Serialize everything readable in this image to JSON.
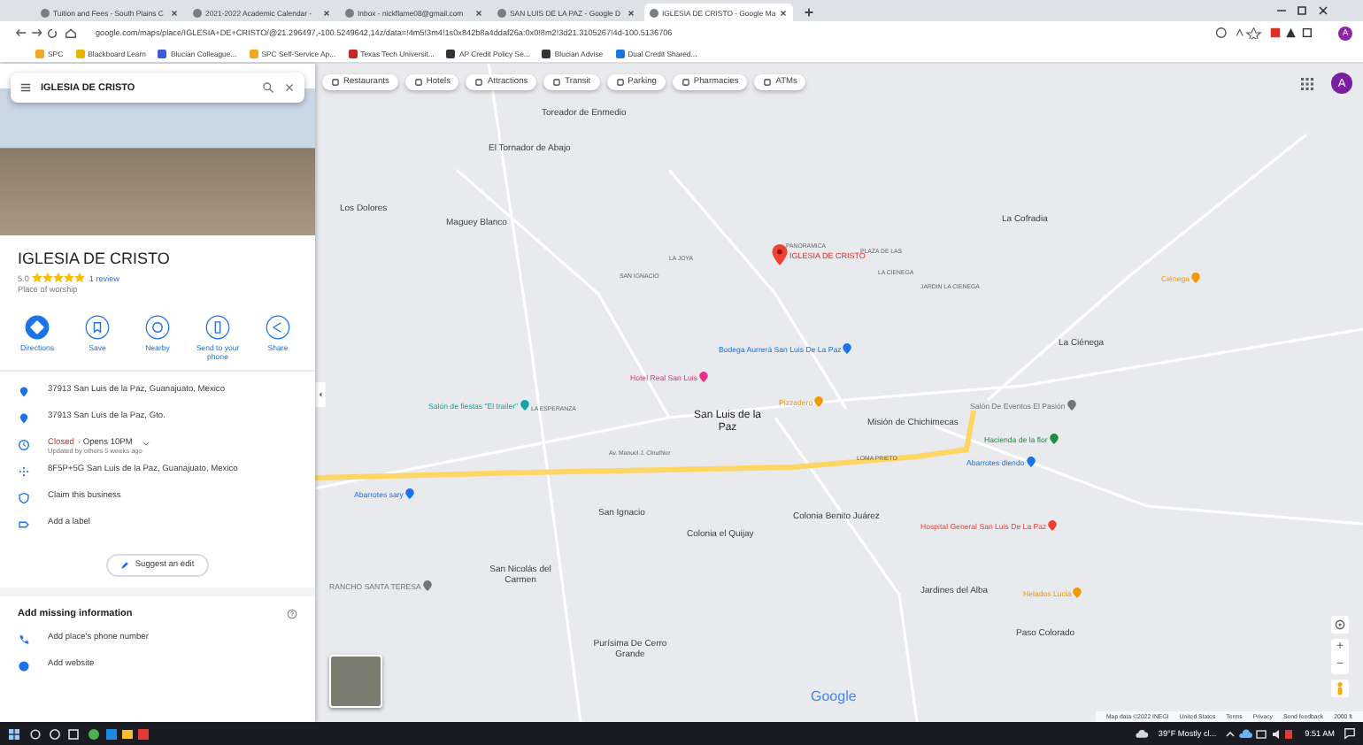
{
  "browser": {
    "tabs": [
      {
        "title": "Tuition and Fees - South Plains C",
        "selected": false
      },
      {
        "title": "2021-2022 Academic Calendar -",
        "selected": false
      },
      {
        "title": "Inbox - nickflame08@gmail.com",
        "selected": false
      },
      {
        "title": "SAN LUIS DE LA PAZ - Google D",
        "selected": false
      },
      {
        "title": "IGLESIA DE CRISTO - Google Ma",
        "selected": true
      }
    ],
    "url": "google.com/maps/place/IGLESIA+DE+CRISTO/@21.296497,-100.5249642,14z/data=!4m5!3m4!1s0x842b8a4ddaf26a:0x0!8m2!3d21.3105267!4d-100.5136706",
    "bookmarks": [
      {
        "label": "SPC",
        "color": "#f5a623"
      },
      {
        "label": "Blackboard Learn",
        "color": "#e8b400"
      },
      {
        "label": "Blucian Colleague...",
        "color": "#3b5bdb"
      },
      {
        "label": "SPC Self-Service Ap...",
        "color": "#f5a623"
      },
      {
        "label": "Texas Tech Universit...",
        "color": "#c62828"
      },
      {
        "label": "AP Credit Policy Se...",
        "color": "#333333"
      },
      {
        "label": "Blucian Advise",
        "color": "#333333"
      },
      {
        "label": "Dual Credit Shared...",
        "color": "#1a73e8"
      }
    ],
    "profile_initial": "A"
  },
  "panel": {
    "search": {
      "value": "IGLESIA DE CRISTO"
    },
    "title": "IGLESIA DE CRISTO",
    "rating": "5.0",
    "stars": 5,
    "reviews": "1 review",
    "category": "Place of worship",
    "actions": [
      {
        "label": "Directions",
        "selected": true
      },
      {
        "label": "Save",
        "selected": false
      },
      {
        "label": "Nearby",
        "selected": false
      },
      {
        "label": "Send to your phone",
        "selected": false
      },
      {
        "label": "Share",
        "selected": false
      }
    ],
    "info": [
      {
        "kind": "address",
        "text": "37913 San Luis de la Paz, Guanajuato, Mexico"
      },
      {
        "kind": "address",
        "text": "37913 San Luis de la Paz, Gto."
      },
      {
        "kind": "hours",
        "status": "Closed",
        "text": "· Opens 10PM",
        "note": "Updated by others 5 weeks ago"
      },
      {
        "kind": "pluscode",
        "text": "8F5P+5G San Luis de la Paz, Guanajuato, Mexico"
      },
      {
        "kind": "claim",
        "text": "Claim this business"
      },
      {
        "kind": "label",
        "text": "Add a label"
      }
    ],
    "suggest": "Suggest an edit",
    "missing_title": "Add missing information",
    "missing": [
      {
        "kind": "phone",
        "text": "Add place's phone number"
      },
      {
        "kind": "website",
        "text": "Add website"
      }
    ]
  },
  "map": {
    "chips": [
      "Restaurants",
      "Hotels",
      "Attractions",
      "Transit",
      "Parking",
      "Pharmacies",
      "ATMs"
    ],
    "avatar": "A",
    "place": {
      "label": "IGLESIA DE CRISTO"
    },
    "labels": [
      {
        "kind": "town",
        "text": "Toreador de Enmedio"
      },
      {
        "kind": "town",
        "text": "El Tornador de Abajo"
      },
      {
        "kind": "town",
        "text": "Los Dolores"
      },
      {
        "kind": "town",
        "text": "Maguey Blanco"
      },
      {
        "kind": "town",
        "text": "La Cofradia"
      },
      {
        "kind": "town",
        "text": "La Ciénega"
      },
      {
        "kind": "city",
        "text": "San Luis de la Paz"
      },
      {
        "kind": "town",
        "text": "Misión de Chichimecas"
      },
      {
        "kind": "town",
        "text": "San Ignacio"
      },
      {
        "kind": "town",
        "text": "Colonia Benito Juárez"
      },
      {
        "kind": "town",
        "text": "Colonia el Quijay"
      },
      {
        "kind": "town",
        "text": "San Nicolás del Carmen"
      },
      {
        "kind": "town",
        "text": "Jardines del Alba"
      },
      {
        "kind": "town",
        "text": "Paso Colorado"
      },
      {
        "kind": "town",
        "text": "Purísima De Cerro Grande"
      },
      {
        "kind": "street",
        "text": "PANORAMICA"
      },
      {
        "kind": "street",
        "text": "PLAZA DE LAS"
      },
      {
        "kind": "street",
        "text": "LA JOYA"
      },
      {
        "kind": "street",
        "text": "LA CIENEGA"
      },
      {
        "kind": "street",
        "text": "JARDIN LA CIENEGA"
      },
      {
        "kind": "street",
        "text": "SAN IGNACIO"
      },
      {
        "kind": "street",
        "text": "LA ESPERANZA"
      },
      {
        "kind": "street",
        "text": "Av. Manuel J. Clouthier"
      },
      {
        "kind": "street",
        "text": "LOMA PRIETO"
      }
    ],
    "pois": [
      {
        "text": "Ciénega",
        "color": "#f29900"
      },
      {
        "text": "Bodega Aurrerá San Luis De La Paz",
        "color": "#1a73e8"
      },
      {
        "text": "Hotel Real San Luis",
        "color": "#e8318a"
      },
      {
        "text": "Pizzadero",
        "color": "#f29900"
      },
      {
        "text": "Salón de fiestas \"El trailer\"",
        "color": "#12a4a4"
      },
      {
        "text": "Salón De Eventos El Pasión",
        "color": "#70757a"
      },
      {
        "text": "Hacienda de la flor",
        "color": "#1e8e3e"
      },
      {
        "text": "Abarrotes diendo",
        "color": "#1a73e8"
      },
      {
        "text": "Abarrotes sary",
        "color": "#1a73e8"
      },
      {
        "text": "Hospital General San Luis De La Paz",
        "color": "#ea4335"
      },
      {
        "text": "Helados Lucia",
        "color": "#f29900"
      },
      {
        "text": "RANCHO SANTA TERESA",
        "color": "#70757a"
      }
    ],
    "logo": "Google",
    "zoom_in": "+",
    "zoom_out": "−",
    "footer": [
      "Map data ©2022 INEGI",
      "United States",
      "Terms",
      "Privacy",
      "Send feedback",
      "2000 ft"
    ]
  },
  "taskbar": {
    "weather": "39°F  Mostly cl...",
    "time": "9:51 AM"
  }
}
